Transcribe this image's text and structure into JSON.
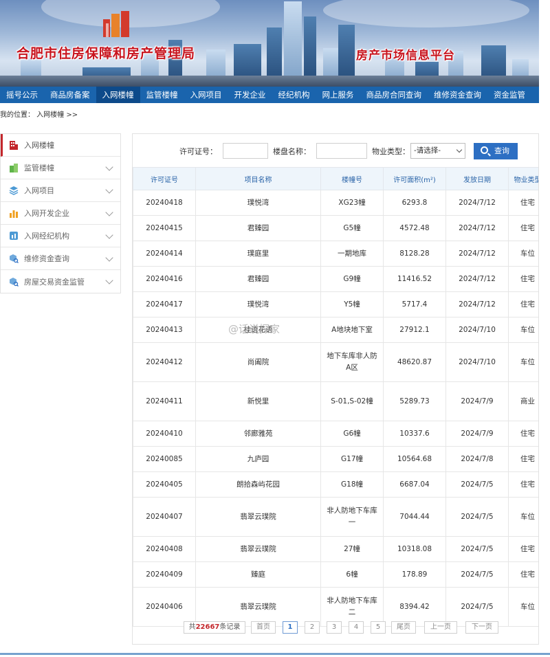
{
  "header": {
    "title": "合肥市住房保障和房产管理局",
    "subtitle": "房产市场信息平台"
  },
  "nav": {
    "items": [
      "摇号公示",
      "商品房备案",
      "入网楼幢",
      "监管楼幢",
      "入网项目",
      "开发企业",
      "经纪机构",
      "网上服务",
      "商品房合同查询",
      "维修资金查询",
      "资金监管"
    ],
    "active_index": 2
  },
  "breadcrumb": "我的位置： 入网楼幢 >>",
  "sidebar": {
    "items": [
      {
        "label": "入网楼幢",
        "icon": "building-icon"
      },
      {
        "label": "监管楼幢",
        "icon": "buildings-icon"
      },
      {
        "label": "入网项目",
        "icon": "layers-icon"
      },
      {
        "label": "入网开发企业",
        "icon": "bar-chart-icon"
      },
      {
        "label": "入网经纪机构",
        "icon": "agency-icon"
      },
      {
        "label": "维修资金查询",
        "icon": "cube-search-icon"
      },
      {
        "label": "房屋交易资金监管",
        "icon": "cube-search-icon"
      }
    ]
  },
  "search": {
    "permit_label": "许可证号：",
    "permit_value": "",
    "project_label": "楼盘名称：",
    "project_value": "",
    "type_label": "物业类型：",
    "type_selected": "-请选择-",
    "button_label": "查询"
  },
  "table": {
    "columns": [
      "许可证号",
      "项目名称",
      "楼幢号",
      "许可面积(m²)",
      "发放日期",
      "物业类型"
    ],
    "rows": [
      [
        "20240418",
        "璞悦湾",
        "XG23幢",
        "6293.8",
        "2024/7/12",
        "住宅"
      ],
      [
        "20240415",
        "君臻园",
        "G5幢",
        "4572.48",
        "2024/7/12",
        "住宅"
      ],
      [
        "20240414",
        "璞庭里",
        "一期地库",
        "8128.28",
        "2024/7/12",
        "车位"
      ],
      [
        "20240416",
        "君臻园",
        "G9幢",
        "11416.52",
        "2024/7/12",
        "住宅"
      ],
      [
        "20240417",
        "璞悦湾",
        "Y5幢",
        "5717.4",
        "2024/7/12",
        "住宅"
      ],
      [
        "20240413",
        "桂语花语",
        "A地块地下室",
        "27912.1",
        "2024/7/10",
        "车位"
      ],
      [
        "20240412",
        "尚阖院",
        "地下车库非人防A区",
        "48620.87",
        "2024/7/10",
        "车位"
      ],
      [
        "20240411",
        "新悦里",
        "S-01,S-02幢",
        "5289.73",
        "2024/7/9",
        "商业"
      ],
      [
        "20240410",
        "邻廊雅苑",
        "G6幢",
        "10337.6",
        "2024/7/9",
        "住宅"
      ],
      [
        "20240085",
        "九庐园",
        "G17幢",
        "10564.68",
        "2024/7/8",
        "住宅"
      ],
      [
        "20240405",
        "朗拾森屿花园",
        "G18幢",
        "6687.04",
        "2024/7/5",
        "住宅"
      ],
      [
        "20240407",
        "翡翠云璞院",
        "非人防地下车库一",
        "7044.44",
        "2024/7/5",
        "车位"
      ],
      [
        "20240408",
        "翡翠云璞院",
        "27幢",
        "10318.08",
        "2024/7/5",
        "住宅"
      ],
      [
        "20240409",
        "臻庭",
        "6幢",
        "178.89",
        "2024/7/5",
        "住宅"
      ],
      [
        "20240406",
        "翡翠云璞院",
        "非人防地下车库二",
        "8394.42",
        "2024/7/5",
        "车位"
      ]
    ]
  },
  "pager": {
    "total_prefix": "共",
    "total_count": "22667",
    "total_suffix": "条记录",
    "first": "首页",
    "pages": [
      "1",
      "2",
      "3",
      "4",
      "5"
    ],
    "current": "1",
    "last": "尾页",
    "prev": "上一页",
    "next": "下一页"
  },
  "watermark": "@话说探家",
  "colors": {
    "nav_bg": "#1a64ad",
    "title_red": "#c8141e",
    "button_blue": "#2d6fc3",
    "header_text_blue": "#2a64a8"
  }
}
